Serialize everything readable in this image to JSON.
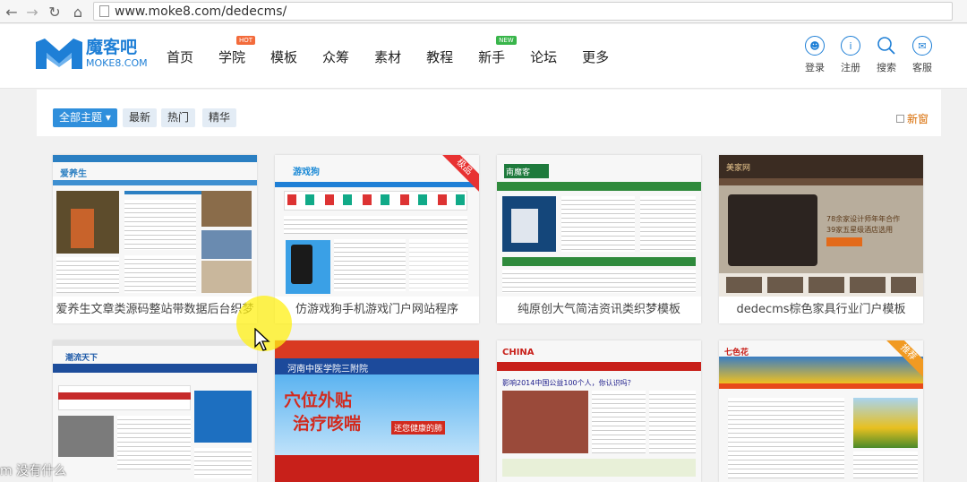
{
  "browser": {
    "url": "www.moke8.com/dedecms/"
  },
  "header": {
    "logo_cn": "魔客吧",
    "logo_en": "MOKE8.COM",
    "nav": [
      {
        "label": "首页"
      },
      {
        "label": "学院",
        "badge": "HOT"
      },
      {
        "label": "模板"
      },
      {
        "label": "众筹"
      },
      {
        "label": "素材"
      },
      {
        "label": "教程"
      },
      {
        "label": "新手",
        "badge": "NEW"
      },
      {
        "label": "论坛"
      },
      {
        "label": "更多"
      }
    ],
    "user_links": [
      {
        "label": "登录",
        "icon": "user-icon"
      },
      {
        "label": "注册",
        "icon": "info-icon"
      },
      {
        "label": "搜索",
        "icon": "search-icon"
      },
      {
        "label": "客服",
        "icon": "service-icon"
      }
    ]
  },
  "filters": {
    "tabs": [
      "全部主题 ▾",
      "最新",
      "热门",
      "精华"
    ],
    "newest": "新窗"
  },
  "cards": [
    {
      "title": "爱养生文章类源码整站带数据后台织梦",
      "ribbon": ""
    },
    {
      "title": "仿游戏狗手机游戏门户网站程序",
      "ribbon": "极品"
    },
    {
      "title": "纯原创大气简洁资讯类织梦模板",
      "ribbon": ""
    },
    {
      "title": "dedecms棕色家具行业门户模板",
      "ribbon": ""
    },
    {
      "title": "",
      "ribbon": ""
    },
    {
      "title": "",
      "ribbon": ""
    },
    {
      "title": "",
      "ribbon": ""
    },
    {
      "title": "",
      "ribbon": "推荐"
    }
  ],
  "thumb_text": {
    "t1_logo": "爱养生",
    "t2_logo": "游戏狗",
    "t3_logo": "南魔客",
    "t4_logo": "美家网",
    "t4_promo1": "78余家设计师年年合作",
    "t4_promo2": "39家五星级酒店选用",
    "t5_logo": "潮流天下",
    "t6_title": "河南中医学院三附院",
    "t6_big1": "穴位外贴",
    "t6_big2": "治疗咳喘",
    "t6_sub": "还您健康的肺",
    "t7_head": "CHINA",
    "t7_news": "影响2014中国公益100个人，你认识吗？",
    "t8_head": "七色花"
  },
  "overlay": {
    "watermark": "m 没有什么"
  },
  "colors": {
    "accent": "#2f8fdc",
    "brand": "#1e7fd6"
  }
}
